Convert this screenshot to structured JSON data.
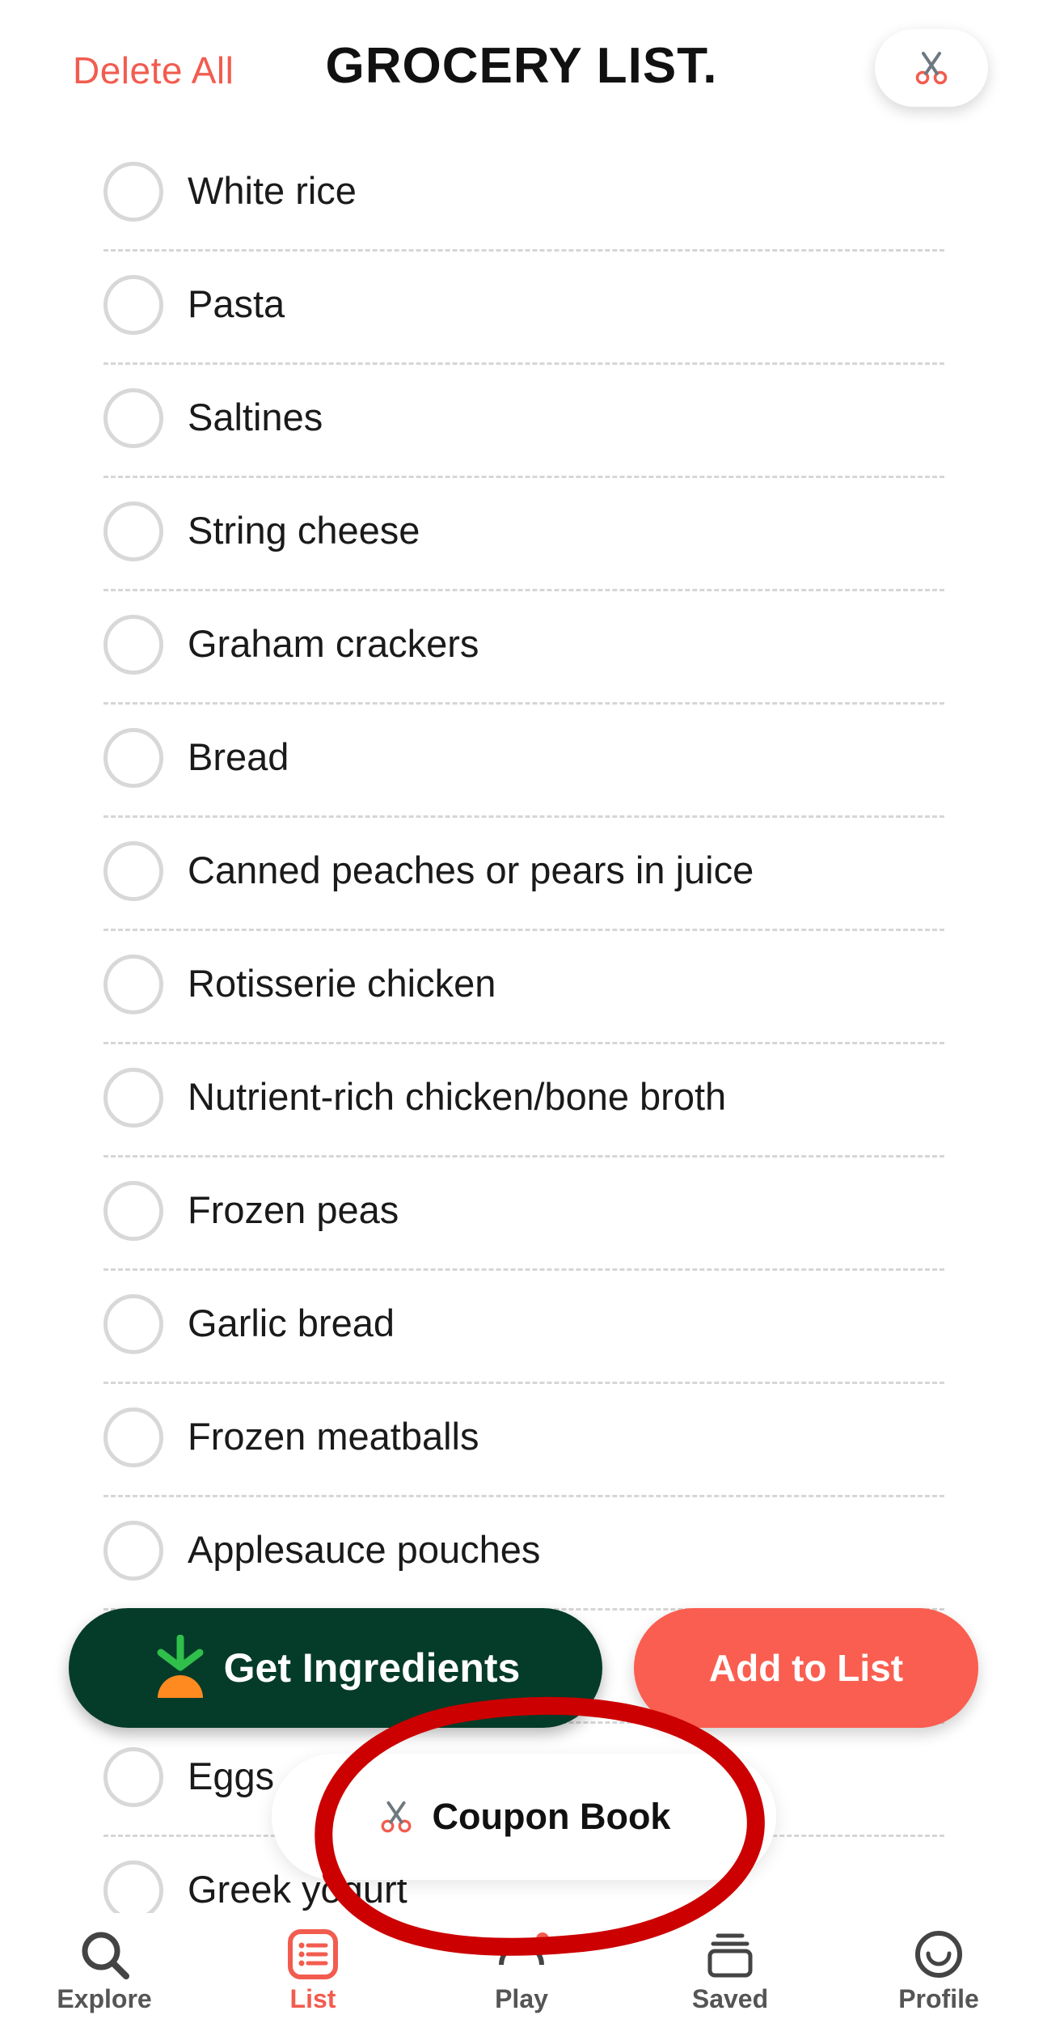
{
  "header": {
    "delete_all": "Delete All",
    "title": "GROCERY LIST.",
    "coupon_icon": "scissors-icon"
  },
  "items": [
    {
      "label": "White rice",
      "checked": false
    },
    {
      "label": "Pasta",
      "checked": false
    },
    {
      "label": "Saltines",
      "checked": false
    },
    {
      "label": "String cheese",
      "checked": false
    },
    {
      "label": "Graham crackers",
      "checked": false
    },
    {
      "label": "Bread",
      "checked": false
    },
    {
      "label": "Canned peaches or pears in juice",
      "checked": false
    },
    {
      "label": "Rotisserie chicken",
      "checked": false
    },
    {
      "label": "Nutrient-rich chicken/bone broth",
      "checked": false
    },
    {
      "label": "Frozen peas",
      "checked": false
    },
    {
      "label": "Garlic bread",
      "checked": false
    },
    {
      "label": "Frozen meatballs",
      "checked": false
    },
    {
      "label": "Applesauce pouches",
      "checked": false
    },
    {
      "label": "",
      "checked": false
    },
    {
      "label": "Eggs",
      "checked": false
    },
    {
      "label": "Greek yogurt",
      "checked": false
    }
  ],
  "actions": {
    "get_ingredients": "Get Ingredients",
    "get_ingredients_icon": "carrot-icon",
    "add_to_list": "Add to List"
  },
  "coupon_book": {
    "label": "Coupon Book",
    "icon": "scissors-icon"
  },
  "tabs": [
    {
      "label": "Explore",
      "icon": "search-icon",
      "active": false
    },
    {
      "label": "List",
      "icon": "list-icon",
      "active": true
    },
    {
      "label": "Play",
      "icon": "play-icon",
      "active": false
    },
    {
      "label": "Saved",
      "icon": "stack-icon",
      "active": false
    },
    {
      "label": "Profile",
      "icon": "smiley-icon",
      "active": false
    }
  ],
  "colors": {
    "accent": "#f25c4f",
    "dark_green": "#053b29",
    "add_button": "#fa5e50",
    "annotation_red": "#cc0000"
  }
}
